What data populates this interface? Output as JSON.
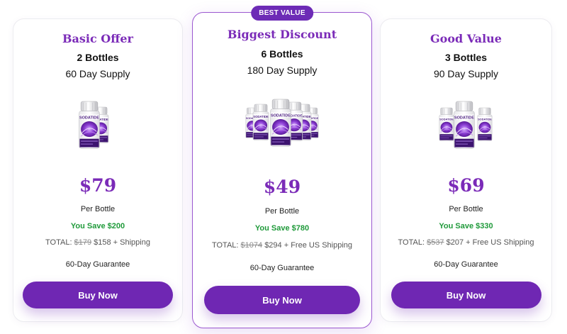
{
  "colors": {
    "accent": "#7b2bb8",
    "button": "#6f27b3",
    "save_green": "#1f9a3a",
    "badge": "#6d2bb6"
  },
  "offers": [
    {
      "title": "Basic Offer",
      "bottles": "2 Bottles",
      "supply": "60 Day Supply",
      "image": "bottle-group-2",
      "price": "$79",
      "per_bottle": "Per Bottle",
      "savings": "You Save $200",
      "total_label": "TOTAL:",
      "total_old": "$179",
      "total_new": "$158 + Shipping",
      "guarantee": "60-Day Guarantee",
      "button": "Buy Now"
    },
    {
      "badge": "BEST VALUE",
      "title": "Biggest Discount",
      "bottles": "6 Bottles",
      "supply": "180 Day Supply",
      "image": "bottle-group-6",
      "price": "$49",
      "per_bottle": "Per Bottle",
      "savings": "You Save $780",
      "total_label": "TOTAL:",
      "total_old": "$1074",
      "total_new": "$294 + Free US Shipping",
      "guarantee": "60-Day Guarantee",
      "button": "Buy Now"
    },
    {
      "title": "Good Value",
      "bottles": "3 Bottles",
      "supply": "90 Day Supply",
      "image": "bottle-group-3",
      "price": "$69",
      "per_bottle": "Per Bottle",
      "savings": "You Save $330",
      "total_label": "TOTAL:",
      "total_old": "$537",
      "total_new": "$207 + Free US Shipping",
      "guarantee": "60-Day Guarantee",
      "button": "Buy Now"
    }
  ],
  "product_label": "SODATIDE"
}
